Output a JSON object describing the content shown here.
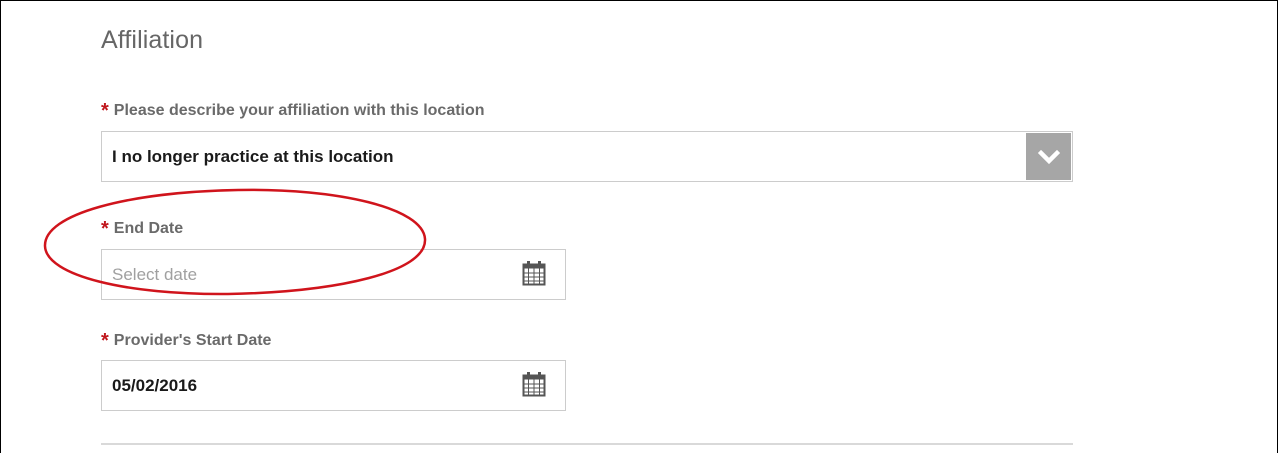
{
  "section": {
    "title": "Affiliation"
  },
  "affiliation": {
    "required_mark": "*",
    "label": "Please describe your affiliation with this location",
    "selected_value": "I no longer practice at this location",
    "arrow_icon": "chevron-down-icon"
  },
  "end_date": {
    "required_mark": "*",
    "label": "End Date",
    "value": "",
    "placeholder": "Select date",
    "icon": "calendar-icon"
  },
  "start_date": {
    "required_mark": "*",
    "label": "Provider's Start Date",
    "value": "05/02/2016",
    "icon": "calendar-icon"
  },
  "colors": {
    "required": "#c0161c",
    "annotation": "#d0141c",
    "select_arrow_bg": "#a6a6a6",
    "label": "#6a6a6a"
  }
}
